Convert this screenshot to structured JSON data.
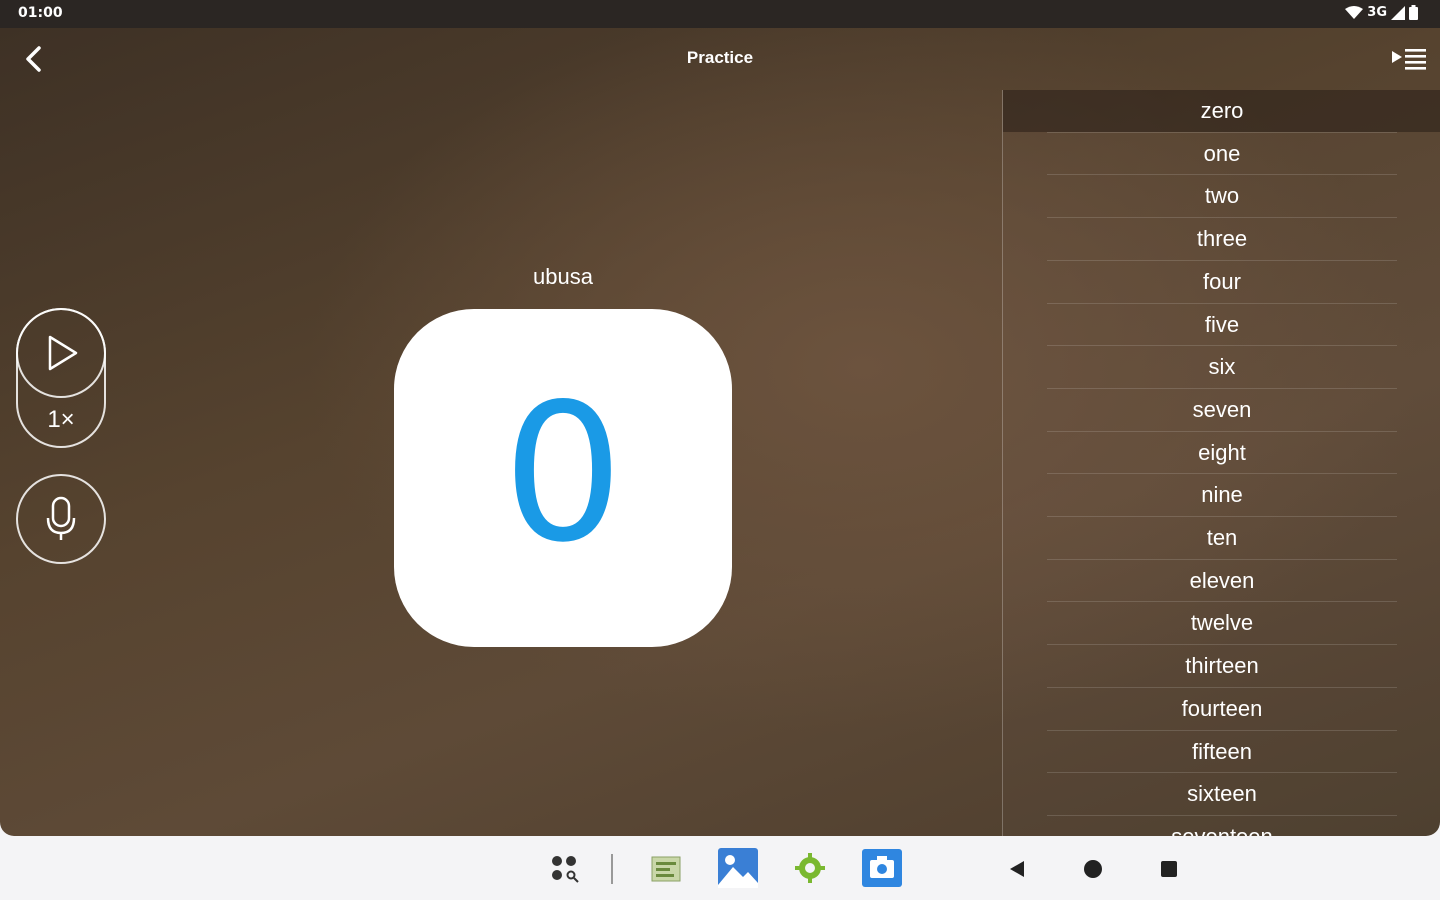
{
  "status": {
    "time": "01:00",
    "network": "3G"
  },
  "appbar": {
    "title": "Practice"
  },
  "card": {
    "word": "ubusa",
    "digit": "0"
  },
  "controls": {
    "speed": "1×"
  },
  "list": {
    "selected_index": 0,
    "items": [
      "zero",
      "one",
      "two",
      "three",
      "four",
      "five",
      "six",
      "seven",
      "eight",
      "nine",
      "ten",
      "eleven",
      "twelve",
      "thirteen",
      "fourteen",
      "fifteen",
      "sixteen",
      "seventeen"
    ]
  },
  "colors": {
    "accent": "#1a9ae6",
    "background": "#56432f",
    "card": "#ffffff"
  },
  "icons": [
    "back-arrow-icon",
    "playlist-icon",
    "play-icon",
    "microphone-icon",
    "wifi-icon",
    "signal-icon",
    "battery-icon",
    "app-grid-icon",
    "gallery-icon",
    "settings-icon",
    "camera-icon",
    "nav-back-icon",
    "nav-home-icon",
    "nav-recents-icon"
  ]
}
